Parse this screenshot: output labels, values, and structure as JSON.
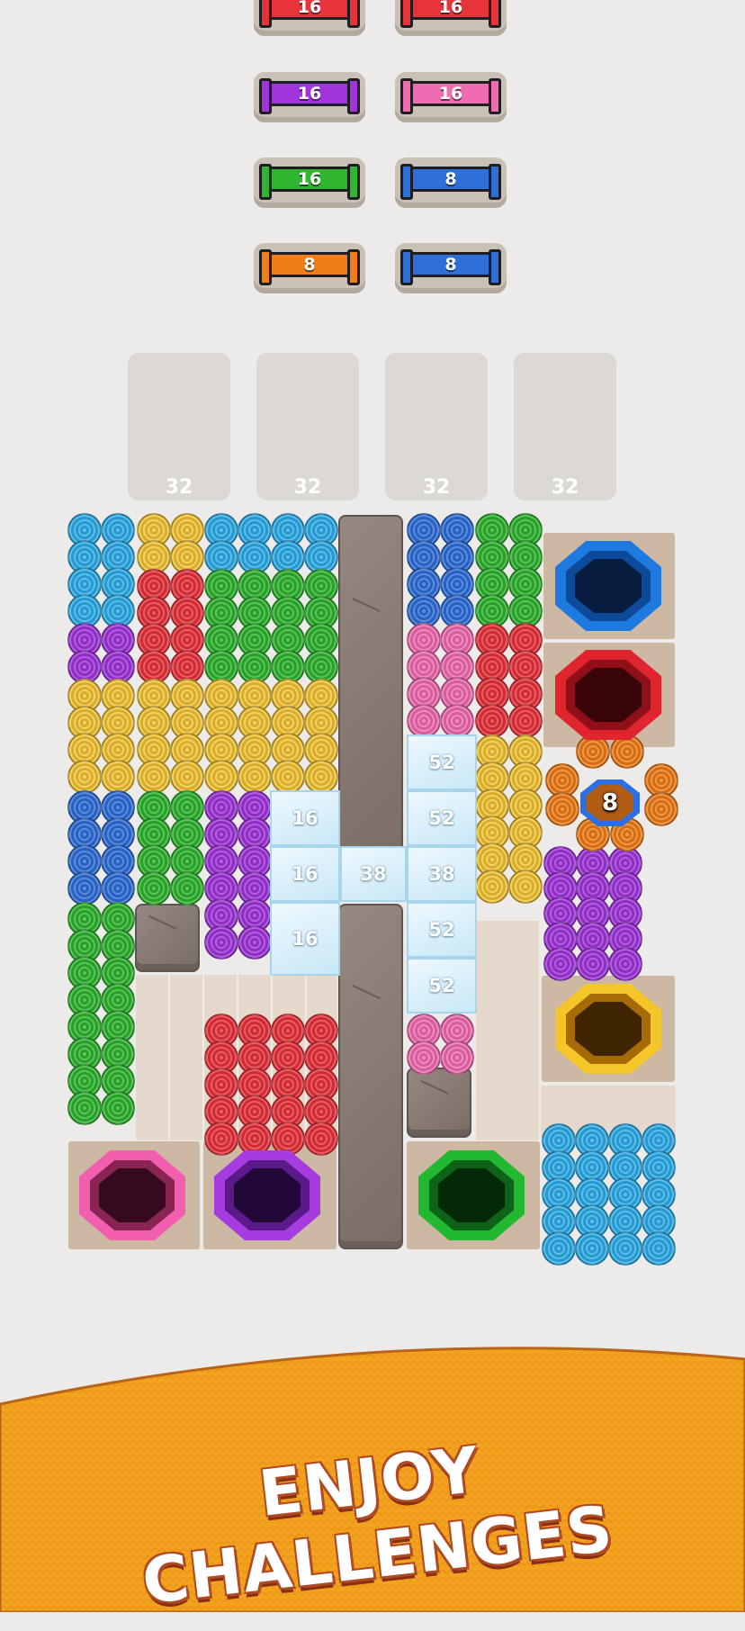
{
  "spool_rack": [
    {
      "color": "red",
      "count": "16"
    },
    {
      "color": "red",
      "count": "16"
    },
    {
      "color": "purple",
      "count": "16"
    },
    {
      "color": "pink",
      "count": "16"
    },
    {
      "color": "green",
      "count": "16"
    },
    {
      "color": "blue",
      "count": "8"
    },
    {
      "color": "orange",
      "count": "8"
    },
    {
      "color": "blue",
      "count": "8"
    }
  ],
  "slots": [
    {
      "capacity": "32"
    },
    {
      "capacity": "32"
    },
    {
      "capacity": "32"
    },
    {
      "capacity": "32"
    }
  ],
  "ice_blocks": [
    {
      "value": "52"
    },
    {
      "value": "16"
    },
    {
      "value": "52"
    },
    {
      "value": "16"
    },
    {
      "value": "38"
    },
    {
      "value": "38"
    },
    {
      "value": "16"
    },
    {
      "value": "52"
    },
    {
      "value": "52"
    }
  ],
  "orange_badge": {
    "value": "8"
  },
  "holes": [
    {
      "color": "blue"
    },
    {
      "color": "red"
    },
    {
      "color": "yellow"
    },
    {
      "color": "pink"
    },
    {
      "color": "purple"
    },
    {
      "color": "green"
    }
  ],
  "colors": {
    "red": "#e8333b",
    "purple": "#a035dc",
    "pink": "#f06cb0",
    "green": "#2fb52f",
    "blue": "#2f6fd8",
    "orange": "#f07d18",
    "cyan": "#2eaee8",
    "yellow": "#f4c534",
    "banner": "#f3a21d"
  },
  "banner": {
    "text": "ENJOY CHALLENGES"
  }
}
